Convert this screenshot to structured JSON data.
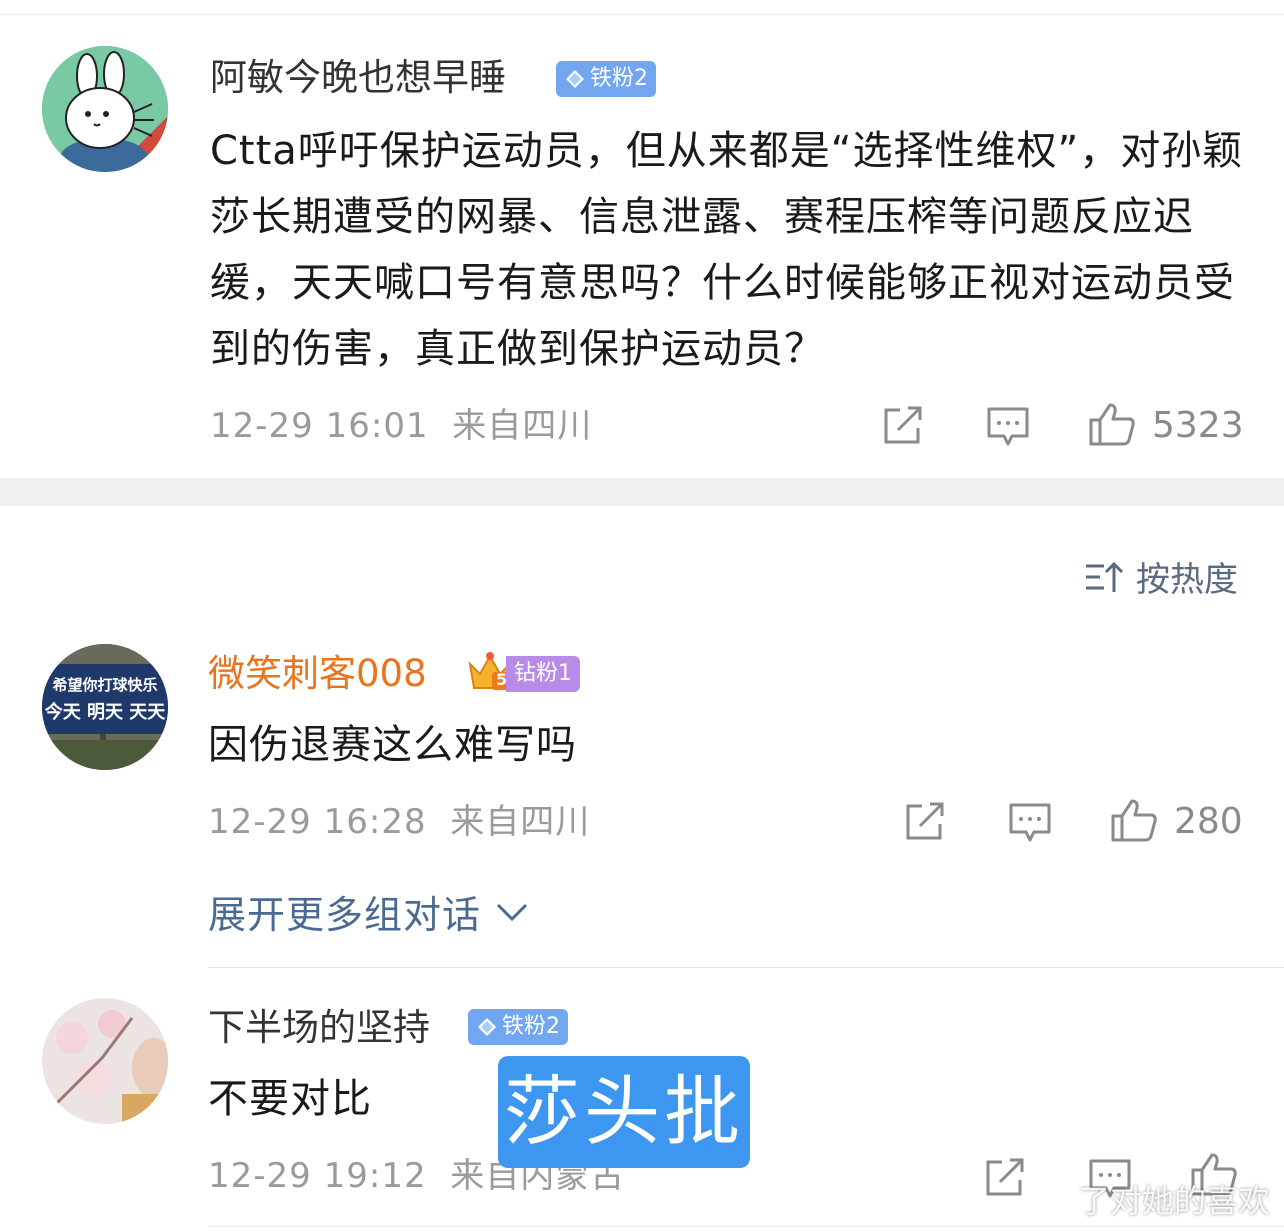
{
  "comments": [
    {
      "username": "阿敏今晚也想早睡",
      "badge": "铁粉2",
      "text": "Ctta呼吁保护运动员，但从来都是“选择性维权”，对孙颖莎长期遭受的网暴、信息泄露、赛程压榨等问题反应迟缓，天天喊口号有意思吗？什么时候能够正视对运动员受到的伤害，真正做到保护运动员？",
      "time": "12-29 16:01",
      "location": "来自四川",
      "likes": "5323",
      "avatar_icon": "rabbit-cartoon-avatar"
    },
    {
      "username": "微笑刺客008",
      "badge": "钻粉1",
      "crown_level": "5",
      "text": "因伤退赛这么难写吗",
      "time": "12-29 16:28",
      "location": "来自四川",
      "likes": "280",
      "avatar_text_line1": "希望你打球快乐",
      "avatar_text_line2": "今天 明天 天天"
    },
    {
      "username": "下半场的坚持",
      "badge": "铁粉2",
      "text": "不要对比",
      "time": "12-29 19:12",
      "location": "来自内蒙古",
      "avatar_icon": "blossom-photo-avatar"
    }
  ],
  "sort_label": "按热度",
  "expand_label": "展开更多组对话",
  "overlay_label": "莎头批",
  "watermark": "了对她的喜欢",
  "colors": {
    "iron_badge": "#6fa2ee",
    "diamond_badge": "#b98be8",
    "vip_name": "#e8751e",
    "link": "#4a6a92",
    "overlay": "#3d97f0"
  }
}
